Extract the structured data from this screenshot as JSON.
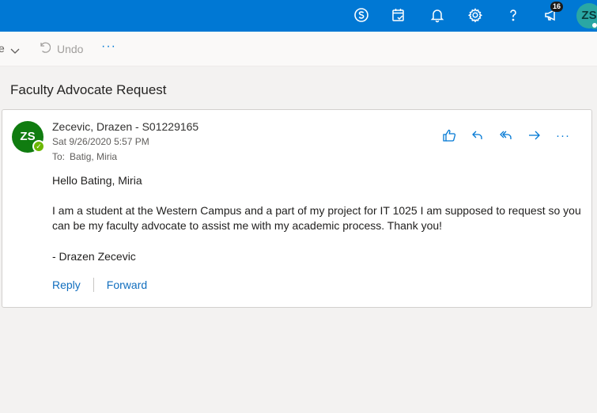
{
  "topbar": {
    "icons": [
      "skype-icon",
      "calendar-tasks-icon",
      "bell-icon",
      "gear-icon",
      "help-icon",
      "megaphone-icon"
    ],
    "notification_count": "16",
    "user_initials": "ZS"
  },
  "toolbar": {
    "left_fragment": "e",
    "undo_label": "Undo",
    "more_label": "···"
  },
  "message": {
    "subject": "Faculty Advocate Request",
    "sender_initials": "ZS",
    "sender": "Zecevic, Drazen - S01229165",
    "date": "Sat 9/26/2020 5:57 PM",
    "to_label": "To:",
    "to_name": "Batig, Miria",
    "greeting": "Hello Bating, Miria",
    "body": "I am a student at the Western Campus and a part of my project for IT 1025 I am supposed to request so you can be my faculty advocate to assist me with my academic process. Thank you!",
    "signature": "- Drazen Zecevic",
    "reply_label": "Reply",
    "forward_label": "Forward",
    "more_label": "···"
  },
  "colors": {
    "topbar": "#0078d4",
    "accent": "#0078d4",
    "sender_avatar": "#107c10"
  }
}
